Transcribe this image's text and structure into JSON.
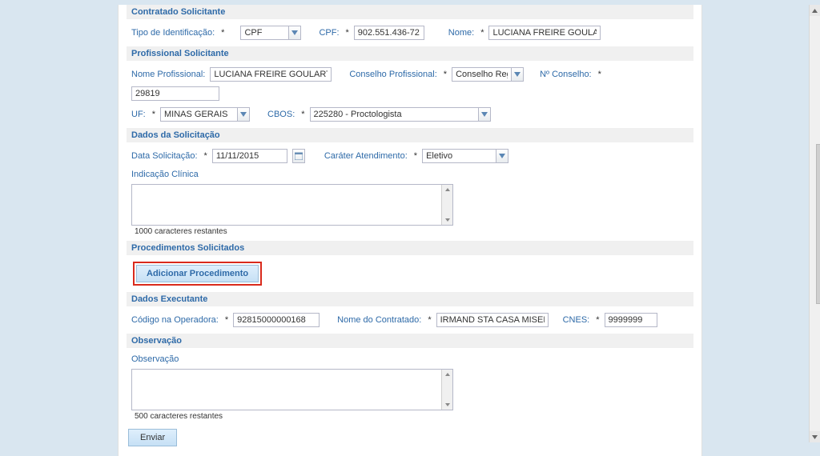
{
  "sections": {
    "contratado": "Contratado Solicitante",
    "profissional": "Profissional Solicitante",
    "dados_solicitacao": "Dados da Solicitação",
    "procedimentos": "Procedimentos Solicitados",
    "dados_executante": "Dados Executante",
    "observacao": "Observação"
  },
  "labels": {
    "tipo_ident": "Tipo de Identificação:",
    "cpf": "CPF:",
    "nome": "Nome:",
    "nome_prof": "Nome Profissional:",
    "conselho_prof": "Conselho Profissional:",
    "n_conselho": "Nº Conselho:",
    "uf": "UF:",
    "cbos": "CBOS:",
    "data_solic": "Data Solicitação:",
    "carater": "Caráter Atendimento:",
    "indicacao": "Indicação Clínica",
    "codigo_op": "Código na Operadora:",
    "nome_contratado": "Nome do Contratado:",
    "cnes": "CNES:",
    "observacao": "Observação",
    "req": "*"
  },
  "values": {
    "tipo_ident": "CPF",
    "cpf": "902.551.436-72",
    "nome": "LUCIANA FREIRE GOULART",
    "nome_prof": "LUCIANA FREIRE GOULART",
    "conselho_prof": "Conselho Regional",
    "n_conselho": "29819",
    "uf": "MINAS GERAIS",
    "cbos": "225280 - Proctologista",
    "data_solic": "11/11/2015",
    "carater": "Eletivo",
    "indicacao": "",
    "codigo_op": "92815000000168",
    "nome_contratado": "IRMAND STA CASA MISERIC PORTO",
    "cnes": "9999999",
    "observacao": ""
  },
  "counters": {
    "indicacao": "1000 caracteres restantes",
    "observacao": "500 caracteres restantes"
  },
  "buttons": {
    "adicionar": "Adicionar Procedimento",
    "enviar": "Enviar"
  }
}
